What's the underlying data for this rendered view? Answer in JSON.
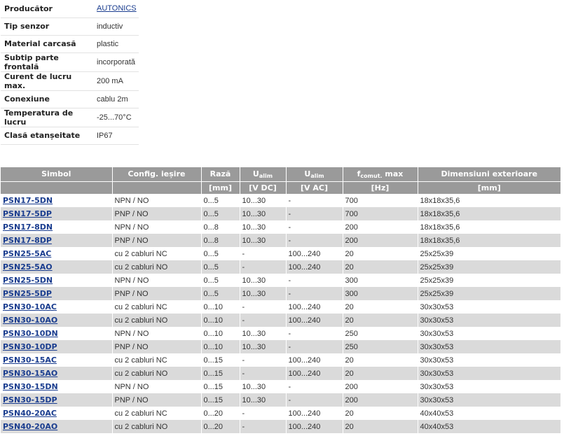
{
  "specs": [
    {
      "key": "Producător",
      "value": "AUTONICS",
      "link": true
    },
    {
      "key": "Tip senzor",
      "value": "inductiv"
    },
    {
      "key": "Material carcasă",
      "value": "plastic"
    },
    {
      "key": "Subtip parte frontală",
      "value": "incorporată"
    },
    {
      "key": "Curent de lucru max.",
      "value": "200 mA"
    },
    {
      "key": "Conexiune",
      "value": "cablu 2m"
    },
    {
      "key": "Temperatura de lucru",
      "value": "-25...70°C"
    },
    {
      "key": "Clasă etanșeitate",
      "value": "IP67"
    }
  ],
  "table": {
    "headers": {
      "symbol": "Simbol",
      "config": "Config. ieșire",
      "range": "Rază",
      "udc_main": "U",
      "udc_sub": "alim",
      "uac_main": "U",
      "uac_sub": "alim",
      "freq_main": "f",
      "freq_sub": "comut.",
      "freq_suffix": " max",
      "dims": "Dimensiuni exterioare"
    },
    "units": [
      "",
      "",
      "[mm]",
      "[V DC]",
      "[V AC]",
      "[Hz]",
      "[mm]"
    ],
    "rows": [
      [
        "PSN17-5DN",
        "NPN / NO",
        "0...5",
        "10...30",
        "-",
        "700",
        "18x18x35,6"
      ],
      [
        "PSN17-5DP",
        "PNP / NO",
        "0...5",
        "10...30",
        "-",
        "700",
        "18x18x35,6"
      ],
      [
        "PSN17-8DN",
        "NPN / NO",
        "0...8",
        "10...30",
        "-",
        "200",
        "18x18x35,6"
      ],
      [
        "PSN17-8DP",
        "PNP / NO",
        "0...8",
        "10...30",
        "-",
        "200",
        "18x18x35,6"
      ],
      [
        "PSN25-5AC",
        "cu 2 cabluri NC",
        "0...5",
        "-",
        "100...240",
        "20",
        "25x25x39"
      ],
      [
        "PSN25-5AO",
        "cu 2 cabluri NO",
        "0...5",
        "-",
        "100...240",
        "20",
        "25x25x39"
      ],
      [
        "PSN25-5DN",
        "NPN / NO",
        "0...5",
        "10...30",
        "-",
        "300",
        "25x25x39"
      ],
      [
        "PSN25-5DP",
        "PNP / NO",
        "0...5",
        "10...30",
        "-",
        "300",
        "25x25x39"
      ],
      [
        "PSN30-10AC",
        "cu 2 cabluri NC",
        "0...10",
        "-",
        "100...240",
        "20",
        "30x30x53"
      ],
      [
        "PSN30-10AO",
        "cu 2 cabluri NO",
        "0...10",
        "-",
        "100...240",
        "20",
        "30x30x53"
      ],
      [
        "PSN30-10DN",
        "NPN / NO",
        "0...10",
        "10...30",
        "-",
        "250",
        "30x30x53"
      ],
      [
        "PSN30-10DP",
        "PNP / NO",
        "0...10",
        "10...30",
        "-",
        "250",
        "30x30x53"
      ],
      [
        "PSN30-15AC",
        "cu 2 cabluri NC",
        "0...15",
        "-",
        "100...240",
        "20",
        "30x30x53"
      ],
      [
        "PSN30-15AO",
        "cu 2 cabluri NO",
        "0...15",
        "-",
        "100...240",
        "20",
        "30x30x53"
      ],
      [
        "PSN30-15DN",
        "NPN / NO",
        "0...15",
        "10...30",
        "-",
        "200",
        "30x30x53"
      ],
      [
        "PSN30-15DP",
        "PNP / NO",
        "0...15",
        "10...30",
        "-",
        "200",
        "30x30x53"
      ],
      [
        "PSN40-20AC",
        "cu 2 cabluri NC",
        "0...20",
        "-",
        "100...240",
        "20",
        "40x40x53"
      ],
      [
        "PSN40-20AO",
        "cu 2 cabluri NO",
        "0...20",
        "-",
        "100...240",
        "20",
        "40x40x53"
      ]
    ]
  },
  "colors": {
    "header_bg": "#9a9a9a",
    "row_alt_bg": "#dadada",
    "link": "#1a3d8f"
  }
}
